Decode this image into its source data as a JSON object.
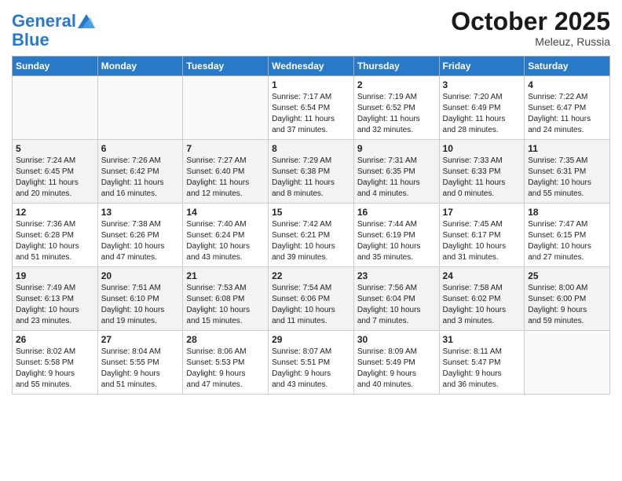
{
  "header": {
    "logo_line1": "General",
    "logo_line2": "Blue",
    "month": "October 2025",
    "location": "Meleuz, Russia"
  },
  "days_of_week": [
    "Sunday",
    "Monday",
    "Tuesday",
    "Wednesday",
    "Thursday",
    "Friday",
    "Saturday"
  ],
  "weeks": [
    [
      {
        "day": "",
        "info": ""
      },
      {
        "day": "",
        "info": ""
      },
      {
        "day": "",
        "info": ""
      },
      {
        "day": "1",
        "info": "Sunrise: 7:17 AM\nSunset: 6:54 PM\nDaylight: 11 hours\nand 37 minutes."
      },
      {
        "day": "2",
        "info": "Sunrise: 7:19 AM\nSunset: 6:52 PM\nDaylight: 11 hours\nand 32 minutes."
      },
      {
        "day": "3",
        "info": "Sunrise: 7:20 AM\nSunset: 6:49 PM\nDaylight: 11 hours\nand 28 minutes."
      },
      {
        "day": "4",
        "info": "Sunrise: 7:22 AM\nSunset: 6:47 PM\nDaylight: 11 hours\nand 24 minutes."
      }
    ],
    [
      {
        "day": "5",
        "info": "Sunrise: 7:24 AM\nSunset: 6:45 PM\nDaylight: 11 hours\nand 20 minutes."
      },
      {
        "day": "6",
        "info": "Sunrise: 7:26 AM\nSunset: 6:42 PM\nDaylight: 11 hours\nand 16 minutes."
      },
      {
        "day": "7",
        "info": "Sunrise: 7:27 AM\nSunset: 6:40 PM\nDaylight: 11 hours\nand 12 minutes."
      },
      {
        "day": "8",
        "info": "Sunrise: 7:29 AM\nSunset: 6:38 PM\nDaylight: 11 hours\nand 8 minutes."
      },
      {
        "day": "9",
        "info": "Sunrise: 7:31 AM\nSunset: 6:35 PM\nDaylight: 11 hours\nand 4 minutes."
      },
      {
        "day": "10",
        "info": "Sunrise: 7:33 AM\nSunset: 6:33 PM\nDaylight: 11 hours\nand 0 minutes."
      },
      {
        "day": "11",
        "info": "Sunrise: 7:35 AM\nSunset: 6:31 PM\nDaylight: 10 hours\nand 55 minutes."
      }
    ],
    [
      {
        "day": "12",
        "info": "Sunrise: 7:36 AM\nSunset: 6:28 PM\nDaylight: 10 hours\nand 51 minutes."
      },
      {
        "day": "13",
        "info": "Sunrise: 7:38 AM\nSunset: 6:26 PM\nDaylight: 10 hours\nand 47 minutes."
      },
      {
        "day": "14",
        "info": "Sunrise: 7:40 AM\nSunset: 6:24 PM\nDaylight: 10 hours\nand 43 minutes."
      },
      {
        "day": "15",
        "info": "Sunrise: 7:42 AM\nSunset: 6:21 PM\nDaylight: 10 hours\nand 39 minutes."
      },
      {
        "day": "16",
        "info": "Sunrise: 7:44 AM\nSunset: 6:19 PM\nDaylight: 10 hours\nand 35 minutes."
      },
      {
        "day": "17",
        "info": "Sunrise: 7:45 AM\nSunset: 6:17 PM\nDaylight: 10 hours\nand 31 minutes."
      },
      {
        "day": "18",
        "info": "Sunrise: 7:47 AM\nSunset: 6:15 PM\nDaylight: 10 hours\nand 27 minutes."
      }
    ],
    [
      {
        "day": "19",
        "info": "Sunrise: 7:49 AM\nSunset: 6:13 PM\nDaylight: 10 hours\nand 23 minutes."
      },
      {
        "day": "20",
        "info": "Sunrise: 7:51 AM\nSunset: 6:10 PM\nDaylight: 10 hours\nand 19 minutes."
      },
      {
        "day": "21",
        "info": "Sunrise: 7:53 AM\nSunset: 6:08 PM\nDaylight: 10 hours\nand 15 minutes."
      },
      {
        "day": "22",
        "info": "Sunrise: 7:54 AM\nSunset: 6:06 PM\nDaylight: 10 hours\nand 11 minutes."
      },
      {
        "day": "23",
        "info": "Sunrise: 7:56 AM\nSunset: 6:04 PM\nDaylight: 10 hours\nand 7 minutes."
      },
      {
        "day": "24",
        "info": "Sunrise: 7:58 AM\nSunset: 6:02 PM\nDaylight: 10 hours\nand 3 minutes."
      },
      {
        "day": "25",
        "info": "Sunrise: 8:00 AM\nSunset: 6:00 PM\nDaylight: 9 hours\nand 59 minutes."
      }
    ],
    [
      {
        "day": "26",
        "info": "Sunrise: 8:02 AM\nSunset: 5:58 PM\nDaylight: 9 hours\nand 55 minutes."
      },
      {
        "day": "27",
        "info": "Sunrise: 8:04 AM\nSunset: 5:55 PM\nDaylight: 9 hours\nand 51 minutes."
      },
      {
        "day": "28",
        "info": "Sunrise: 8:06 AM\nSunset: 5:53 PM\nDaylight: 9 hours\nand 47 minutes."
      },
      {
        "day": "29",
        "info": "Sunrise: 8:07 AM\nSunset: 5:51 PM\nDaylight: 9 hours\nand 43 minutes."
      },
      {
        "day": "30",
        "info": "Sunrise: 8:09 AM\nSunset: 5:49 PM\nDaylight: 9 hours\nand 40 minutes."
      },
      {
        "day": "31",
        "info": "Sunrise: 8:11 AM\nSunset: 5:47 PM\nDaylight: 9 hours\nand 36 minutes."
      },
      {
        "day": "",
        "info": ""
      }
    ]
  ]
}
